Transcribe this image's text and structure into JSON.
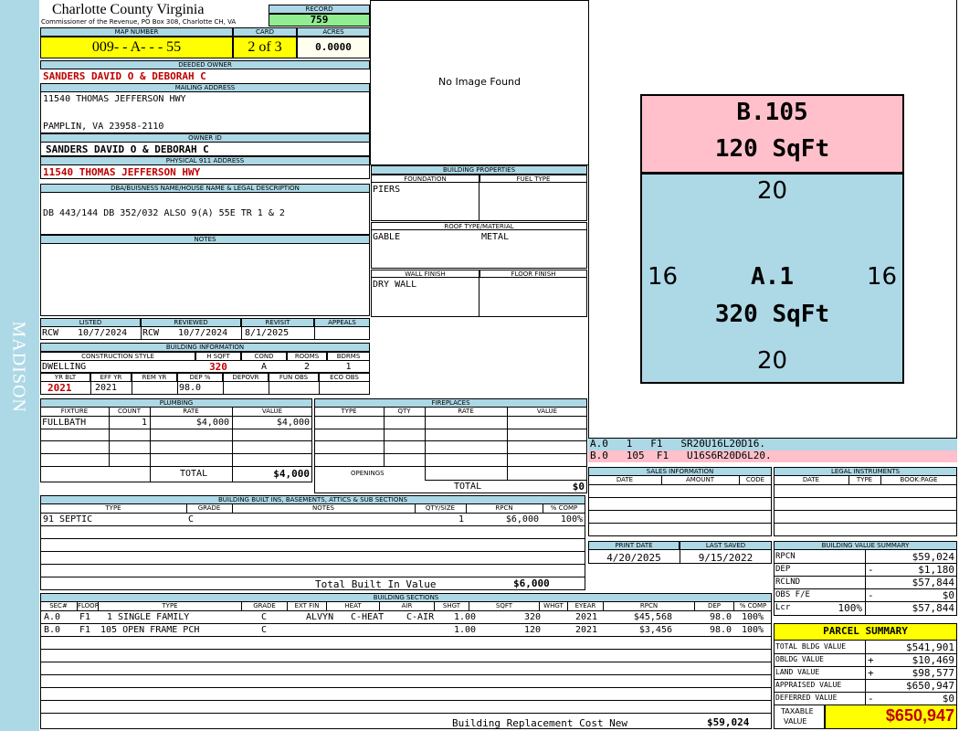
{
  "side_label": "MADISON",
  "header": {
    "county": "Charlotte County Virginia",
    "subtitle": "Commissioner of the Revenue, PO Box 308, Charlotte CH, VA",
    "record_label": "RECORD",
    "record": "759",
    "map_number_label": "MAP NUMBER",
    "map_number": "009- - A- - - 55",
    "card_label": "CARD",
    "card": "2 of 3",
    "acres_label": "ACRES",
    "acres": "0.0000"
  },
  "owner": {
    "deeded_owner_label": "DEEDED OWNER",
    "deeded_owner": "SANDERS DAVID O & DEBORAH C",
    "mailing_label": "MAILING ADDRESS",
    "mailing_line1": "11540 THOMAS JEFFERSON HWY",
    "mailing_line2": "PAMPLIN, VA 23958-2110",
    "owner_id_label": "OWNER ID",
    "owner_id": "SANDERS DAVID O & DEBORAH C",
    "physical_label": "PHYSICAL 911 ADDRESS",
    "physical": "11540 THOMAS JEFFERSON HWY",
    "dba_label": "DBA/BUISNESS NAME/HOUSE NAME & LEGAL DESCRIPTION",
    "legal": "DB 443/144 DB 352/032 ALSO 9(A) 55E TR 1 & 2",
    "notes_label": "NOTES"
  },
  "image": {
    "text": "No Image Found"
  },
  "building_properties": {
    "title": "BUILDING PROPERTIES",
    "foundation_label": "FOUNDATION",
    "foundation": "PIERS",
    "fuel_label": "FUEL TYPE",
    "fuel": "",
    "roof_label": "ROOF TYPE/MATERIAL",
    "roof_type": "GABLE",
    "roof_material": "METAL",
    "wall_label": "WALL FINISH",
    "wall": "DRY WALL",
    "floor_label": "FLOOR FINISH",
    "floor": ""
  },
  "sketch": {
    "b_label": "B.105",
    "b_area": "120 SqFt",
    "a_label": "A.1",
    "a_area": "320 SqFt",
    "a_top": "20",
    "a_bottom": "20",
    "a_left": "16",
    "a_right": "16",
    "legend_a": "A.0   1   F1   SR20U16L20D16.",
    "legend_b": "B.0   105  F1   U16S6R20D6L20."
  },
  "listing": {
    "listed_label": "LISTED",
    "listed_by": "RCW",
    "listed_date": "10/7/2024",
    "reviewed_label": "REVIEWED",
    "reviewed_by": "RCW",
    "reviewed_date": "10/7/2024",
    "revisit_label": "REVISIT",
    "revisit": "8/1/2025",
    "appeals_label": "APPEALS",
    "appeals": ""
  },
  "building_info": {
    "title": "BUILDING INFORMATION",
    "style_label": "CONSTRUCTION STYLE",
    "style": "DWELLING",
    "hsqft_label": "H SQFT",
    "hsqft": "320",
    "cond_label": "COND",
    "cond": "A",
    "rooms_label": "ROOMS",
    "rooms": "2",
    "bdrms_label": "BDRMS",
    "bdrms": "1",
    "yrblt_label": "YR BLT",
    "yrblt": "2021",
    "effyr_label": "EFF YR",
    "effyr": "2021",
    "remyr_label": "REM YR",
    "remyr": "",
    "dep_label": "DEP %",
    "dep": "98.0",
    "depovr_label": "DEPOVR",
    "funobs_label": "FUN OBS",
    "ecoobs_label": "ECO OBS"
  },
  "plumbing": {
    "title": "PLUMBING",
    "cols": [
      "FIXTURE",
      "COUNT",
      "RATE",
      "VALUE"
    ],
    "fixture": "FULLBATH",
    "count": "1",
    "rate": "$4,000",
    "value": "$4,000",
    "total_label": "TOTAL",
    "total": "$4,000"
  },
  "fireplaces": {
    "title": "FIREPLACES",
    "cols": [
      "TYPE",
      "QTY",
      "RATE",
      "VALUE"
    ],
    "openings_label": "OPENINGS",
    "total_label": "TOTAL",
    "total": "$0"
  },
  "sales": {
    "title": "SALES INFORMATION",
    "cols": [
      "DATE",
      "AMOUNT",
      "CODE"
    ]
  },
  "legal_instruments": {
    "title": "LEGAL INSTRUMENTS",
    "cols": [
      "DATE",
      "TYPE",
      "BOOK:PAGE"
    ]
  },
  "print": {
    "print_label": "PRINT DATE",
    "print_date": "4/20/2025",
    "saved_label": "LAST SAVED",
    "saved_date": "9/15/2022"
  },
  "builtins": {
    "title": "BUILDING BUILT INS, BASEMENTS, ATTICS & SUB SECTIONS",
    "cols": [
      "TYPE",
      "GRADE",
      "NOTES",
      "QTY/SIZE",
      "RPCN",
      "% COMP"
    ],
    "row_type": "91 SEPTIC",
    "row_grade": "C",
    "row_notes": "",
    "row_qty": "1",
    "row_rpcn": "$6,000",
    "row_comp": "100%",
    "total_label": "Total Built In Value",
    "total": "$6,000"
  },
  "value_summary": {
    "title": "BUILDING VALUE SUMMARY",
    "rpcn_label": "RPCN",
    "rpcn": "$59,024",
    "dep_label": "DEP",
    "dep_sign": "-",
    "dep": "$1,180",
    "rclnd_label": "RCLND",
    "rclnd": "$57,844",
    "obs_label": "OBS F/E",
    "obs_sign": "-",
    "obs": "$0",
    "lcr_label": "Lcr",
    "lcr_pct": "100%",
    "lcr": "$57,844"
  },
  "sections": {
    "title": "BUILDING SECTIONS",
    "cols": [
      "SEC#",
      "FLOOR",
      "TYPE",
      "GRADE",
      "EXT FIN",
      "HEAT",
      "AIR",
      "SHGT",
      "SQFT",
      "WHGT",
      "EYEAR",
      "RPCN",
      "DEP",
      "% COMP"
    ],
    "rows": [
      {
        "sec": "A.0",
        "floor": "F1",
        "type": "1 SINGLE FAMILY",
        "grade": "C",
        "ext": "ALVYN",
        "heat": "C-HEAT",
        "air": "C-AIR",
        "shgt": "1.00",
        "sqft": "320",
        "whgt": "",
        "eyear": "2021",
        "rpcn": "$45,568",
        "dep": "98.0",
        "comp": "100%"
      },
      {
        "sec": "B.0",
        "floor": "F1",
        "type": "105 OPEN FRAME PCH",
        "grade": "C",
        "ext": "",
        "heat": "",
        "air": "",
        "shgt": "1.00",
        "sqft": "120",
        "whgt": "",
        "eyear": "2021",
        "rpcn": "$3,456",
        "dep": "98.0",
        "comp": "100%"
      }
    ],
    "total_label": "Building Replacement Cost New",
    "total": "$59,024"
  },
  "parcel_summary": {
    "title": "PARCEL SUMMARY",
    "total_bldg_label": "TOTAL BLDG VALUE",
    "total_bldg": "$541,901",
    "obldg_label": "OBLDG VALUE",
    "obldg_sign": "+",
    "obldg": "$10,469",
    "land_label": "LAND VALUE",
    "land_sign": "+",
    "land": "$98,577",
    "appraised_label": "APPRAISED VALUE",
    "appraised": "$650,947",
    "deferred_label": "DEFERRED VALUE",
    "deferred_sign": "-",
    "deferred": "$0",
    "taxable_label1": "TAXABLE",
    "taxable_label2": "VALUE",
    "taxable": "$650,947"
  }
}
